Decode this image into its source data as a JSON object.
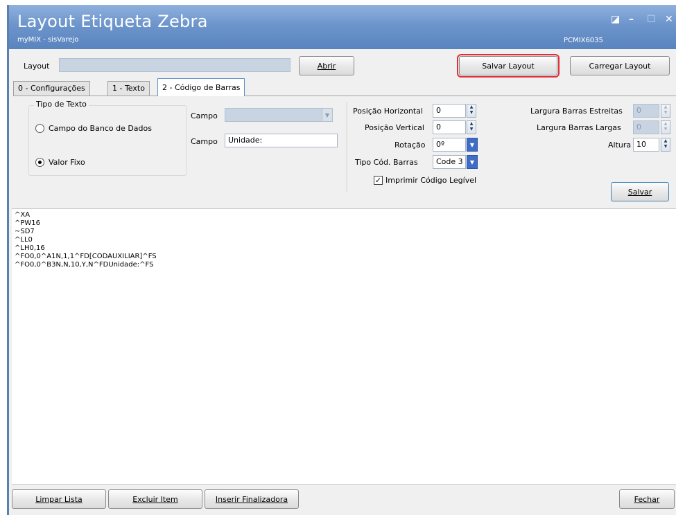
{
  "window": {
    "title": "Layout Etiqueta Zebra",
    "subtitle": "myMIX - sisVarejo",
    "code": "PCMIX6035",
    "controls": [
      "restore-icon",
      "minimize-icon",
      "maximize-icon",
      "close-icon"
    ]
  },
  "top": {
    "layout_label": "Layout",
    "layout_value": "",
    "abrir_label": "Abrir",
    "salvar_layout_label": "Salvar Layout",
    "carregar_layout_label": "Carregar Layout"
  },
  "tabs": [
    {
      "label": "0 - Configurações"
    },
    {
      "label": "1 - Texto"
    },
    {
      "label": "2 - Código de Barras"
    }
  ],
  "panel": {
    "tipo_texto_title": "Tipo de Texto",
    "radio_banco": "Campo do Banco de Dados",
    "radio_fixo": "Valor Fixo",
    "campo1_label": "Campo",
    "campo1_value": "",
    "campo2_label": "Campo",
    "campo2_value": "Unidade:",
    "pos_h_label": "Posição Horizontal",
    "pos_h_value": "0",
    "pos_v_label": "Posição Vertical",
    "pos_v_value": "0",
    "rotacao_label": "Rotação",
    "rotacao_value": "0º",
    "tipo_cod_label": "Tipo Cód. Barras",
    "tipo_cod_value": "Code 3",
    "imprimir_label": "Imprimir Código Legível",
    "largura_estreitas_label": "Largura Barras Estreitas",
    "largura_estreitas_value": "0",
    "largura_largas_label": "Largura Barras Largas",
    "largura_largas_value": "0",
    "altura_label": "Altura",
    "altura_value": "10",
    "salvar_label": "Salvar"
  },
  "code_lines": [
    "^XA",
    "^PW16",
    "~SD7",
    "^LL0",
    "^LH0,16",
    "^FO0,0^A1N,1,1^FD[CODAUXILIAR]^FS",
    "^FO0,0^B3N,N,10,Y,N^FDUnidade:^FS"
  ],
  "bottom": {
    "limpar_label": "Limpar Lista",
    "excluir_label": "Excluir Item",
    "inserir_label": "Inserir Finalizadora",
    "fechar_label": "Fechar"
  },
  "colors": {
    "titlebar": "#6d95cc",
    "highlight": "#e0303a",
    "disabled_field": "#c9d4e2"
  }
}
